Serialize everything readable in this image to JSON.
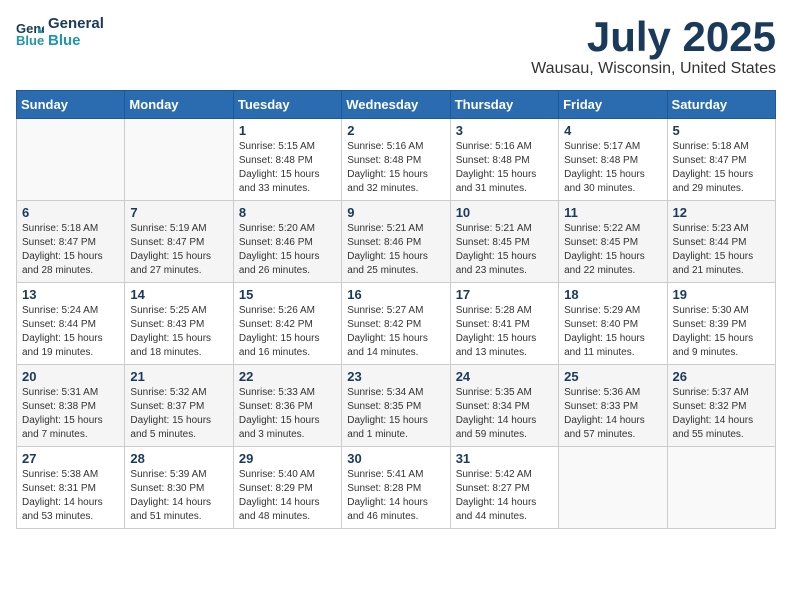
{
  "logo": {
    "line1": "General",
    "line2": "Blue"
  },
  "title": "July 2025",
  "location": "Wausau, Wisconsin, United States",
  "weekdays": [
    "Sunday",
    "Monday",
    "Tuesday",
    "Wednesday",
    "Thursday",
    "Friday",
    "Saturday"
  ],
  "weeks": [
    [
      {
        "day": "",
        "sunrise": "",
        "sunset": "",
        "daylight": ""
      },
      {
        "day": "",
        "sunrise": "",
        "sunset": "",
        "daylight": ""
      },
      {
        "day": "1",
        "sunrise": "Sunrise: 5:15 AM",
        "sunset": "Sunset: 8:48 PM",
        "daylight": "Daylight: 15 hours and 33 minutes."
      },
      {
        "day": "2",
        "sunrise": "Sunrise: 5:16 AM",
        "sunset": "Sunset: 8:48 PM",
        "daylight": "Daylight: 15 hours and 32 minutes."
      },
      {
        "day": "3",
        "sunrise": "Sunrise: 5:16 AM",
        "sunset": "Sunset: 8:48 PM",
        "daylight": "Daylight: 15 hours and 31 minutes."
      },
      {
        "day": "4",
        "sunrise": "Sunrise: 5:17 AM",
        "sunset": "Sunset: 8:48 PM",
        "daylight": "Daylight: 15 hours and 30 minutes."
      },
      {
        "day": "5",
        "sunrise": "Sunrise: 5:18 AM",
        "sunset": "Sunset: 8:47 PM",
        "daylight": "Daylight: 15 hours and 29 minutes."
      }
    ],
    [
      {
        "day": "6",
        "sunrise": "Sunrise: 5:18 AM",
        "sunset": "Sunset: 8:47 PM",
        "daylight": "Daylight: 15 hours and 28 minutes."
      },
      {
        "day": "7",
        "sunrise": "Sunrise: 5:19 AM",
        "sunset": "Sunset: 8:47 PM",
        "daylight": "Daylight: 15 hours and 27 minutes."
      },
      {
        "day": "8",
        "sunrise": "Sunrise: 5:20 AM",
        "sunset": "Sunset: 8:46 PM",
        "daylight": "Daylight: 15 hours and 26 minutes."
      },
      {
        "day": "9",
        "sunrise": "Sunrise: 5:21 AM",
        "sunset": "Sunset: 8:46 PM",
        "daylight": "Daylight: 15 hours and 25 minutes."
      },
      {
        "day": "10",
        "sunrise": "Sunrise: 5:21 AM",
        "sunset": "Sunset: 8:45 PM",
        "daylight": "Daylight: 15 hours and 23 minutes."
      },
      {
        "day": "11",
        "sunrise": "Sunrise: 5:22 AM",
        "sunset": "Sunset: 8:45 PM",
        "daylight": "Daylight: 15 hours and 22 minutes."
      },
      {
        "day": "12",
        "sunrise": "Sunrise: 5:23 AM",
        "sunset": "Sunset: 8:44 PM",
        "daylight": "Daylight: 15 hours and 21 minutes."
      }
    ],
    [
      {
        "day": "13",
        "sunrise": "Sunrise: 5:24 AM",
        "sunset": "Sunset: 8:44 PM",
        "daylight": "Daylight: 15 hours and 19 minutes."
      },
      {
        "day": "14",
        "sunrise": "Sunrise: 5:25 AM",
        "sunset": "Sunset: 8:43 PM",
        "daylight": "Daylight: 15 hours and 18 minutes."
      },
      {
        "day": "15",
        "sunrise": "Sunrise: 5:26 AM",
        "sunset": "Sunset: 8:42 PM",
        "daylight": "Daylight: 15 hours and 16 minutes."
      },
      {
        "day": "16",
        "sunrise": "Sunrise: 5:27 AM",
        "sunset": "Sunset: 8:42 PM",
        "daylight": "Daylight: 15 hours and 14 minutes."
      },
      {
        "day": "17",
        "sunrise": "Sunrise: 5:28 AM",
        "sunset": "Sunset: 8:41 PM",
        "daylight": "Daylight: 15 hours and 13 minutes."
      },
      {
        "day": "18",
        "sunrise": "Sunrise: 5:29 AM",
        "sunset": "Sunset: 8:40 PM",
        "daylight": "Daylight: 15 hours and 11 minutes."
      },
      {
        "day": "19",
        "sunrise": "Sunrise: 5:30 AM",
        "sunset": "Sunset: 8:39 PM",
        "daylight": "Daylight: 15 hours and 9 minutes."
      }
    ],
    [
      {
        "day": "20",
        "sunrise": "Sunrise: 5:31 AM",
        "sunset": "Sunset: 8:38 PM",
        "daylight": "Daylight: 15 hours and 7 minutes."
      },
      {
        "day": "21",
        "sunrise": "Sunrise: 5:32 AM",
        "sunset": "Sunset: 8:37 PM",
        "daylight": "Daylight: 15 hours and 5 minutes."
      },
      {
        "day": "22",
        "sunrise": "Sunrise: 5:33 AM",
        "sunset": "Sunset: 8:36 PM",
        "daylight": "Daylight: 15 hours and 3 minutes."
      },
      {
        "day": "23",
        "sunrise": "Sunrise: 5:34 AM",
        "sunset": "Sunset: 8:35 PM",
        "daylight": "Daylight: 15 hours and 1 minute."
      },
      {
        "day": "24",
        "sunrise": "Sunrise: 5:35 AM",
        "sunset": "Sunset: 8:34 PM",
        "daylight": "Daylight: 14 hours and 59 minutes."
      },
      {
        "day": "25",
        "sunrise": "Sunrise: 5:36 AM",
        "sunset": "Sunset: 8:33 PM",
        "daylight": "Daylight: 14 hours and 57 minutes."
      },
      {
        "day": "26",
        "sunrise": "Sunrise: 5:37 AM",
        "sunset": "Sunset: 8:32 PM",
        "daylight": "Daylight: 14 hours and 55 minutes."
      }
    ],
    [
      {
        "day": "27",
        "sunrise": "Sunrise: 5:38 AM",
        "sunset": "Sunset: 8:31 PM",
        "daylight": "Daylight: 14 hours and 53 minutes."
      },
      {
        "day": "28",
        "sunrise": "Sunrise: 5:39 AM",
        "sunset": "Sunset: 8:30 PM",
        "daylight": "Daylight: 14 hours and 51 minutes."
      },
      {
        "day": "29",
        "sunrise": "Sunrise: 5:40 AM",
        "sunset": "Sunset: 8:29 PM",
        "daylight": "Daylight: 14 hours and 48 minutes."
      },
      {
        "day": "30",
        "sunrise": "Sunrise: 5:41 AM",
        "sunset": "Sunset: 8:28 PM",
        "daylight": "Daylight: 14 hours and 46 minutes."
      },
      {
        "day": "31",
        "sunrise": "Sunrise: 5:42 AM",
        "sunset": "Sunset: 8:27 PM",
        "daylight": "Daylight: 14 hours and 44 minutes."
      },
      {
        "day": "",
        "sunrise": "",
        "sunset": "",
        "daylight": ""
      },
      {
        "day": "",
        "sunrise": "",
        "sunset": "",
        "daylight": ""
      }
    ]
  ]
}
